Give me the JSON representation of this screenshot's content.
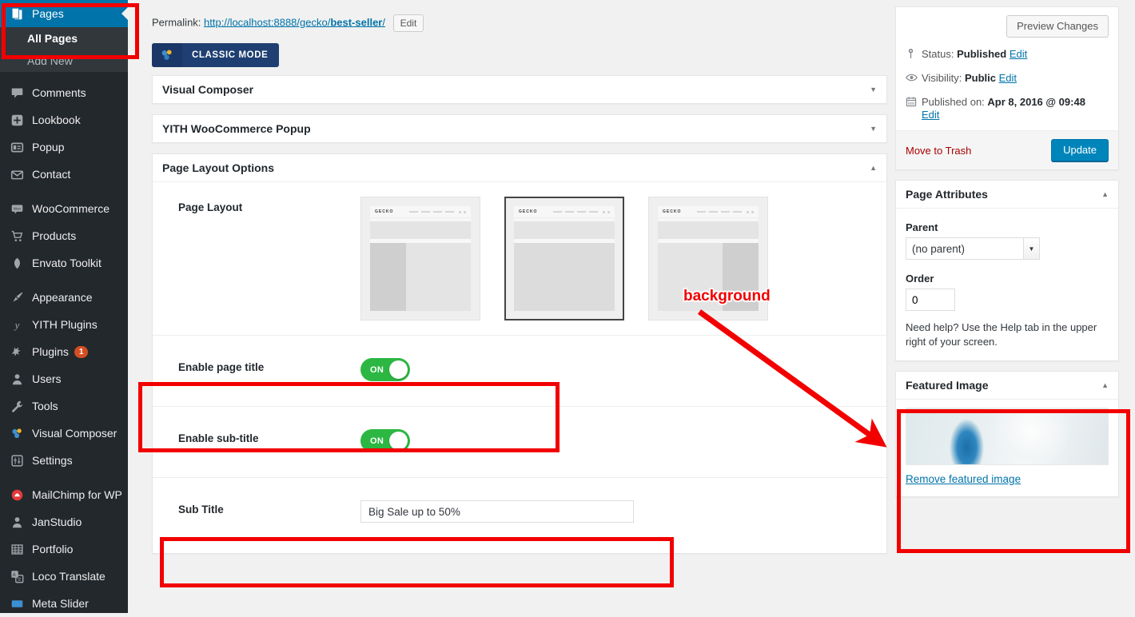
{
  "sidebar": {
    "items": [
      {
        "label": "Pages",
        "icon": "pages-icon",
        "current": true
      },
      {
        "label": "Comments",
        "icon": "comments-icon"
      },
      {
        "label": "Lookbook",
        "icon": "plus-box-icon"
      },
      {
        "label": "Popup",
        "icon": "popup-icon"
      },
      {
        "label": "Contact",
        "icon": "envelope-icon"
      },
      {
        "label": "WooCommerce",
        "icon": "woocommerce-icon"
      },
      {
        "label": "Products",
        "icon": "cart-icon"
      },
      {
        "label": "Envato Toolkit",
        "icon": "leaf-icon"
      },
      {
        "label": "Appearance",
        "icon": "paintbrush-icon"
      },
      {
        "label": "YITH Plugins",
        "icon": "yith-icon"
      },
      {
        "label": "Plugins",
        "icon": "plug-icon",
        "badge": "1"
      },
      {
        "label": "Users",
        "icon": "user-icon"
      },
      {
        "label": "Tools",
        "icon": "wrench-icon"
      },
      {
        "label": "Visual Composer",
        "icon": "visual-composer-icon"
      },
      {
        "label": "Settings",
        "icon": "settings-sliders-icon"
      },
      {
        "label": "MailChimp for WP",
        "icon": "mailchimp-icon"
      },
      {
        "label": "JanStudio",
        "icon": "user-icon"
      },
      {
        "label": "Portfolio",
        "icon": "grid-icon"
      },
      {
        "label": "Loco Translate",
        "icon": "translate-icon"
      },
      {
        "label": "Meta Slider",
        "icon": "slider-icon"
      }
    ],
    "submenu": [
      {
        "label": "All Pages",
        "current": true
      },
      {
        "label": "Add New",
        "current": false
      }
    ]
  },
  "permalink": {
    "prefix_label": "Permalink:",
    "url_base": "http://localhost:8888/gecko/",
    "url_slug": "best-seller",
    "url_suffix": "/",
    "edit_button": "Edit"
  },
  "vc_button": {
    "label": "CLASSIC MODE"
  },
  "metaboxes": [
    {
      "title": "Visual Composer",
      "collapsed": true
    },
    {
      "title": "YITH WooCommerce Popup",
      "collapsed": true
    }
  ],
  "page_layout_options": {
    "title": "Page Layout Options",
    "rows": {
      "page_layout": {
        "label": "Page Layout",
        "choices": [
          {
            "name": "left-sidebar",
            "logo": "GECKO",
            "selected": false
          },
          {
            "name": "full-width",
            "logo": "GECKO",
            "selected": true
          },
          {
            "name": "right-sidebar",
            "logo": "GECKO",
            "selected": false
          }
        ]
      },
      "enable_page_title": {
        "label": "Enable page title",
        "state": "ON"
      },
      "enable_sub_title": {
        "label": "Enable sub-title",
        "state": "ON"
      },
      "sub_title": {
        "label": "Sub Title",
        "value": "Big Sale up to 50%",
        "placeholder": ""
      }
    }
  },
  "publish_box": {
    "preview_button": "Preview Changes",
    "status_label": "Status:",
    "status_value": "Published",
    "status_edit": "Edit",
    "visibility_label": "Visibility:",
    "visibility_value": "Public",
    "visibility_edit": "Edit",
    "published_label": "Published on:",
    "published_value": "Apr 8, 2016 @ 09:48",
    "published_edit": "Edit",
    "trash_link": "Move to Trash",
    "update_button": "Update"
  },
  "page_attributes": {
    "title": "Page Attributes",
    "parent_label": "Parent",
    "parent_value": "(no parent)",
    "order_label": "Order",
    "order_value": "0",
    "help_text": "Need help? Use the Help tab in the upper right of your screen."
  },
  "featured_image": {
    "title": "Featured Image",
    "remove_link": "Remove featured image"
  },
  "annotations": {
    "background_label": "background"
  },
  "colors": {
    "admin_menu_bg": "#23282d",
    "admin_submenu_bg": "#32373c",
    "current_menu_bg": "#0073aa",
    "link": "#0073aa",
    "toggle_on": "#2cb742",
    "annotation_red": "#f20000",
    "primary_button": "#0085ba",
    "trash_red": "#a00",
    "badge": "#d54e21"
  }
}
